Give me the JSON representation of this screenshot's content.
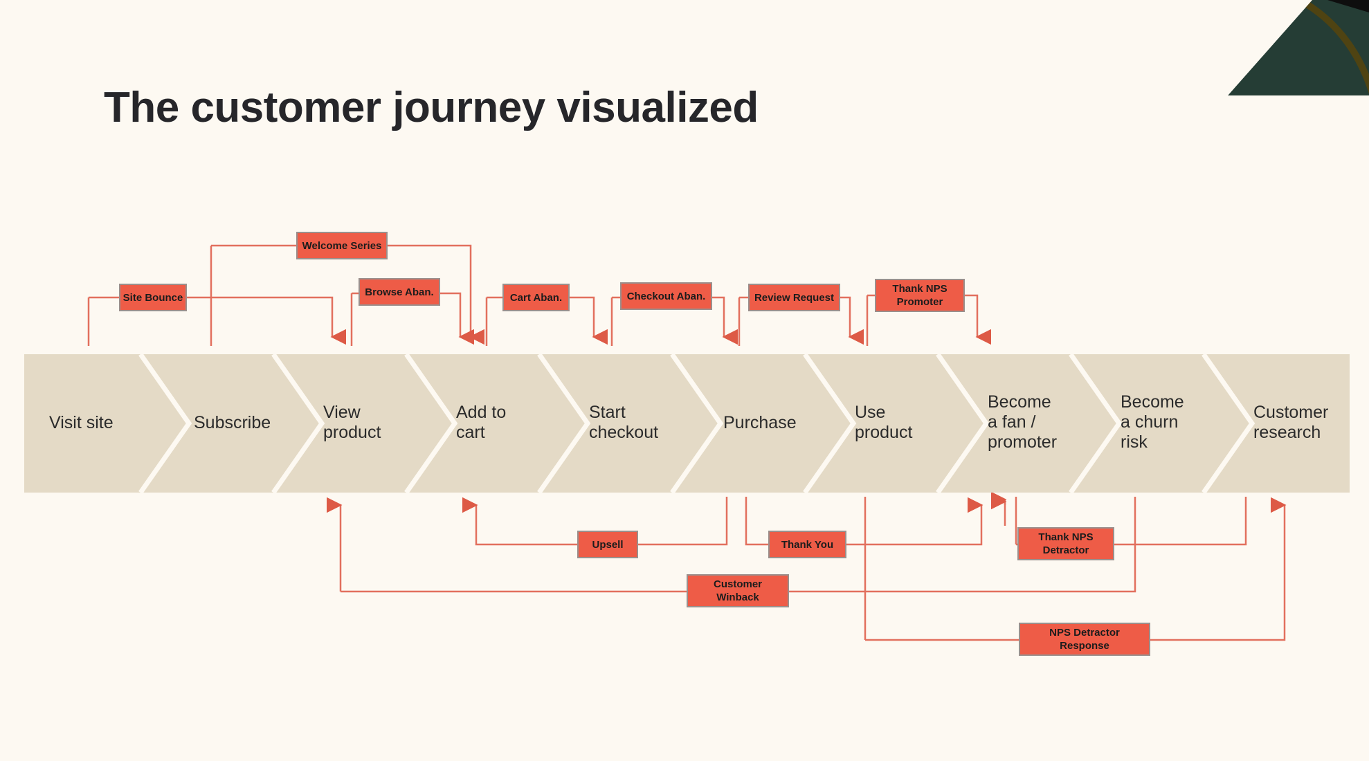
{
  "page": {
    "title": "The customer journey visualized",
    "background_color": "#fdf9f2",
    "band_color": "#e4dac6",
    "campaign_color": "#ee5c47",
    "connector_color": "#e2705e",
    "decor_green": "#253d35",
    "decor_gold": "#4f4312"
  },
  "journey": {
    "stages": [
      {
        "label": "Visit site"
      },
      {
        "label": "Subscribe"
      },
      {
        "label": "View\nproduct"
      },
      {
        "label": "Add to\ncart"
      },
      {
        "label": "Start\ncheckout"
      },
      {
        "label": "Purchase"
      },
      {
        "label": "Use\nproduct"
      },
      {
        "label": "Become\na fan /\npromoter"
      },
      {
        "label": "Become\na churn\nrisk"
      },
      {
        "label": "Customer\nresearch"
      }
    ]
  },
  "campaigns_above": [
    {
      "label": "Welcome Series"
    },
    {
      "label": "Site Bounce"
    },
    {
      "label": "Browse Aban."
    },
    {
      "label": "Cart Aban."
    },
    {
      "label": "Checkout Aban."
    },
    {
      "label": "Review Request"
    },
    {
      "label": "Thank NPS\nPromoter"
    }
  ],
  "campaigns_below": [
    {
      "label": "Upsell"
    },
    {
      "label": "Thank You"
    },
    {
      "label": "Thank NPS\nDetractor"
    },
    {
      "label": "Customer\nWinback"
    },
    {
      "label": "NPS Detractor\nResponse"
    }
  ]
}
